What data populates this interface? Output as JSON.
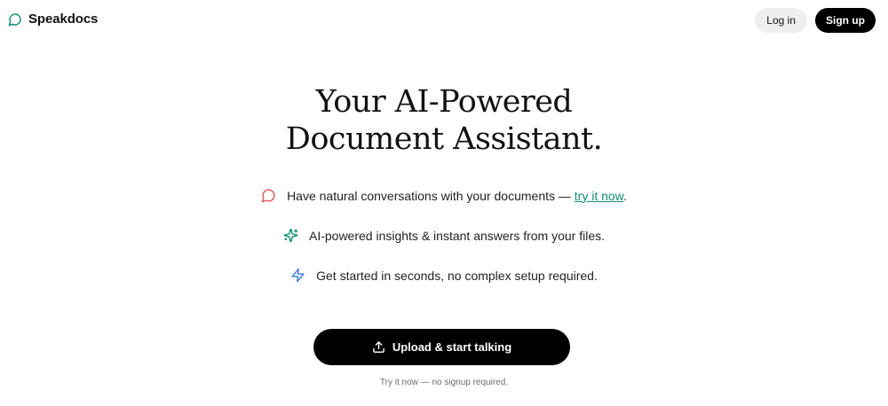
{
  "brand": {
    "name": "Speakdocs",
    "icon": "chat-bubble-icon",
    "color": "#0f8f6d"
  },
  "auth": {
    "login_label": "Log in",
    "signup_label": "Sign up"
  },
  "hero": {
    "title_line1": "Your AI-Powered",
    "title_line2": "Document Assistant."
  },
  "features": [
    {
      "icon": "chat-bubble-icon",
      "icon_color": "#e0565b",
      "text": "Have natural conversations with your documents — ",
      "link_text": "try it now",
      "suffix": "."
    },
    {
      "icon": "sparkles-icon",
      "icon_color": "#0f8f6d",
      "text": "AI-powered insights & instant answers from your files."
    },
    {
      "icon": "lightning-bolt-icon",
      "icon_color": "#3b7de0",
      "text": "Get started in seconds, no complex setup required."
    }
  ],
  "cta": {
    "label": "Upload & start talking",
    "icon": "upload-icon"
  },
  "note": "Try it now — no signup required."
}
